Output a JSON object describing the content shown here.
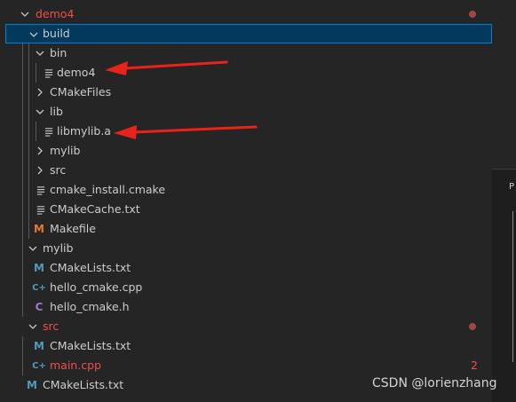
{
  "tree": {
    "items": [
      {
        "label": "demo4",
        "type": "folder",
        "open": true,
        "modified": true,
        "icon": "chevron-down-icon"
      },
      {
        "label": "build",
        "type": "folder",
        "open": true,
        "selected": true,
        "icon": "chevron-down-icon"
      },
      {
        "label": "bin",
        "type": "folder",
        "open": true,
        "icon": "chevron-down-icon"
      },
      {
        "label": "demo4",
        "type": "file",
        "icon": "lines-file-icon"
      },
      {
        "label": "CMakeFiles",
        "type": "folder",
        "open": false,
        "icon": "chevron-right-icon"
      },
      {
        "label": "lib",
        "type": "folder",
        "open": true,
        "icon": "chevron-down-icon"
      },
      {
        "label": "libmylib.a",
        "type": "file",
        "icon": "lines-file-icon"
      },
      {
        "label": "mylib",
        "type": "folder",
        "open": false,
        "icon": "chevron-right-icon"
      },
      {
        "label": "src",
        "type": "folder",
        "open": false,
        "icon": "chevron-right-icon"
      },
      {
        "label": "cmake_install.cmake",
        "type": "file",
        "icon": "lines-file-icon"
      },
      {
        "label": "CMakeCache.txt",
        "type": "file",
        "icon": "lines-file-icon"
      },
      {
        "label": "Makefile",
        "type": "file",
        "icon": "makefile-m-icon",
        "glyph": "M"
      },
      {
        "label": "mylib",
        "type": "folder",
        "open": true,
        "icon": "chevron-down-icon"
      },
      {
        "label": "CMakeLists.txt",
        "type": "file",
        "icon": "cmake-m-icon",
        "glyph": "M"
      },
      {
        "label": "hello_cmake.cpp",
        "type": "file",
        "icon": "cpp-icon",
        "glyph": "C+"
      },
      {
        "label": "hello_cmake.h",
        "type": "file",
        "icon": "c-header-icon",
        "glyph": "C"
      },
      {
        "label": "src",
        "type": "folder",
        "open": true,
        "modified": true,
        "icon": "chevron-down-icon"
      },
      {
        "label": "CMakeLists.txt",
        "type": "file",
        "icon": "cmake-m-icon",
        "glyph": "M"
      },
      {
        "label": "main.cpp",
        "type": "file",
        "modified": true,
        "badge": "2",
        "icon": "cpp-icon",
        "glyph": "C+"
      },
      {
        "label": "CMakeLists.txt",
        "type": "file",
        "icon": "cmake-m-icon",
        "glyph": "M"
      }
    ]
  },
  "right_pane_text": "P",
  "watermark": "CSDN @lorienzhang",
  "colors": {
    "background": "#252526",
    "selected_bg": "#04395e",
    "selected_border": "#007fd4",
    "modified_red": "#f14c4c",
    "arrow_red": "#e8231a",
    "cmake_blue": "#519aba",
    "makefile_orange": "#e37933",
    "cpp_blue": "#519aba",
    "header_purple": "#a074c4"
  }
}
